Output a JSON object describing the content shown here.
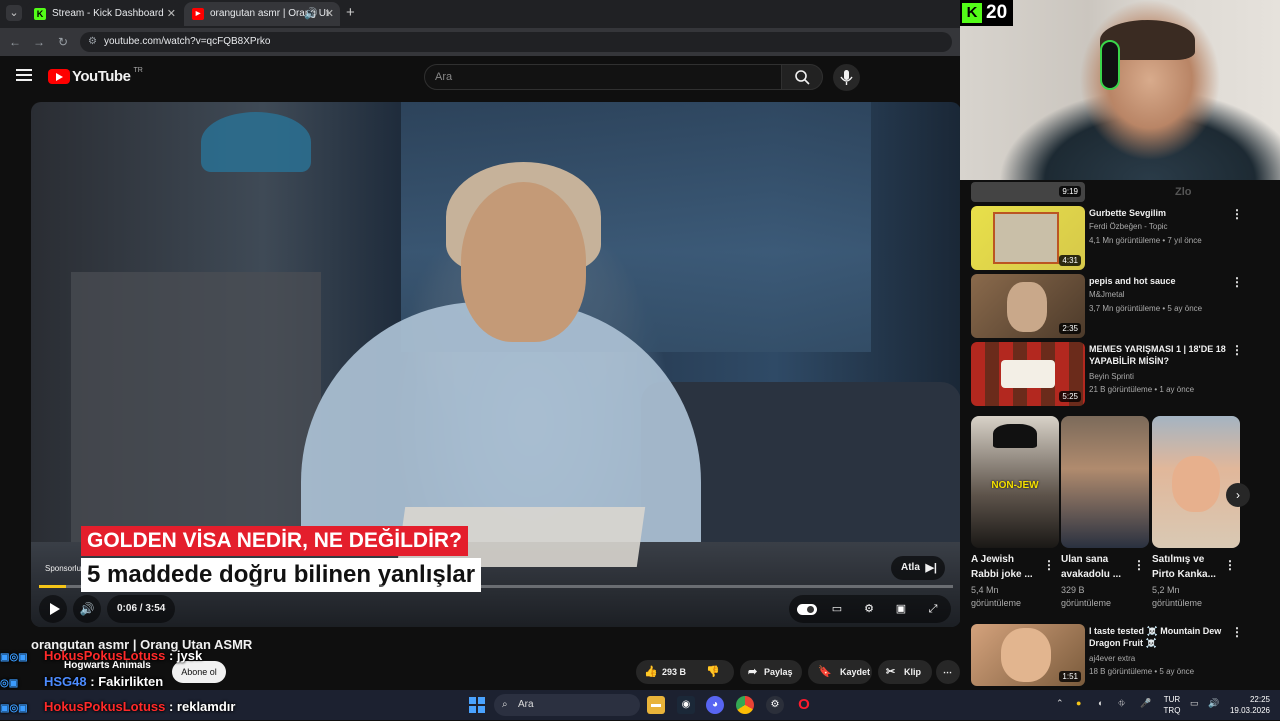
{
  "browser": {
    "tabs": [
      {
        "label": "Stream - Kick Dashboard",
        "icon": "kick-icon"
      },
      {
        "label": "orangutan asmr | Orang Ut",
        "icon": "youtube-icon",
        "audio_icon": "speaker-icon"
      }
    ],
    "url": "youtube.com/watch?v=qcFQB8XPrko"
  },
  "youtube": {
    "logo_word": "YouTube",
    "country_code": "TR",
    "search_placeholder": "Ara",
    "video": {
      "caption_line1": "GOLDEN VİSA NEDİR, NE DEĞİLDİR?",
      "caption_line2": "5 maddede doğru bilinen yanlışlar",
      "sponsored_label": "Sponsorlu",
      "skip_label": "Atla",
      "time": "0:06 / 3:54",
      "progress_fraction": 0.03
    },
    "title": "orangutan asmr | Orang Utan ASMR",
    "channel": "Hogwarts Animals",
    "subscribe_label": "Abone ol",
    "actions": {
      "likes": "293 B",
      "share": "Paylaş",
      "save": "Kaydet",
      "clip": "Klip"
    }
  },
  "chat": [
    {
      "user": "HokusPokusLotuss",
      "message": ": jysk"
    },
    {
      "user": "HSG48",
      "message": ": Fakirlikten"
    },
    {
      "user": "HokusPokusLotuss",
      "message": ": reklamdır"
    }
  ],
  "stream": {
    "kick_viewers": "20",
    "watermark": "Zlo"
  },
  "recommendations": [
    {
      "duration": "9:19"
    },
    {
      "title": "Gurbette Sevgilim",
      "channel": "Ferdi Özbeğen - Topic",
      "meta": "4,1 Mn görüntüleme • 7 yıl önce",
      "duration": "4:31"
    },
    {
      "title": "pepis and hot sauce",
      "channel": "M&Jmetal",
      "meta": "3,7 Mn görüntüleme • 5 ay önce",
      "duration": "2:35"
    },
    {
      "title": "MEMES YARIŞMASI 1 | 18'DE 18 YAPABİLİR MİSİN?",
      "channel": "Beyin Sprinti",
      "meta": "21 B görüntüleme • 1 ay önce",
      "duration": "5:25"
    },
    {
      "title": "I taste tested ☠️ Mountain Dew Dragon Fruit ☠️",
      "channel": "aj4ever extra",
      "meta": "18 B görüntüleme • 5 ay önce",
      "duration": "1:51"
    }
  ],
  "shorts": [
    {
      "title": "A Jewish Rabbi joke ...",
      "views": "5,4 Mn görüntüleme",
      "overlay": "NON-JEW"
    },
    {
      "title": "Ulan sana avakadolu ...",
      "views": "329 B görüntüleme",
      "overlay": ""
    },
    {
      "title": "Satılmış ve Pirto Kanka...",
      "views": "5,2 Mn görüntüleme",
      "overlay": ""
    }
  ],
  "taskbar": {
    "search_placeholder": "Ara",
    "lang_top": "TUR",
    "lang_bottom": "TRQ",
    "time": "22:25",
    "date": "19.03.2026"
  }
}
